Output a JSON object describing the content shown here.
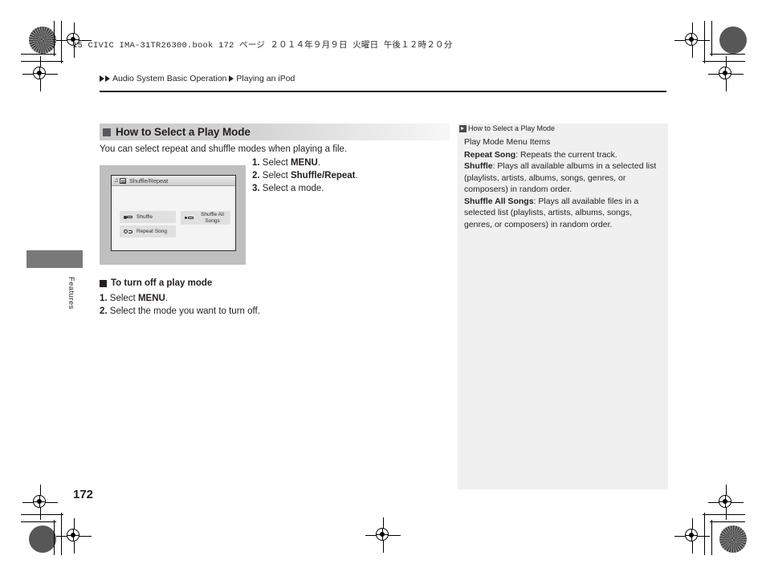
{
  "print": {
    "book_line": "15 CIVIC IMA-31TR26300.book   172 ページ   ２０１４年９月９日   火曜日   午後１２時２０分"
  },
  "breadcrumb": {
    "section": "Audio System Basic Operation",
    "topic": "Playing an iPod",
    "arrow_icon": "triangle-right-icon"
  },
  "heading": {
    "bullet_icon": "filled-square-icon",
    "title": "How to Select a Play Mode"
  },
  "intro": "You can select repeat and shuffle modes when playing a file.",
  "steps": [
    {
      "num": "1.",
      "pre": "Select ",
      "bold": "MENU",
      "post": "."
    },
    {
      "num": "2.",
      "pre": "Select ",
      "bold": "Shuffle/Repeat",
      "post": "."
    },
    {
      "num": "3.",
      "pre": "Select a mode.",
      "bold": "",
      "post": ""
    }
  ],
  "illustration": {
    "title_bar": {
      "music_note_icon": "music-note-icon",
      "list_icon": "list-screen-icon",
      "label": "Shuffle/Repeat"
    },
    "buttons": [
      {
        "icon": "shuffle-icon",
        "label": "Shuffle"
      },
      {
        "icon": "repeat-song-icon",
        "label": "Repeat Song"
      },
      {
        "icon": "shuffle-all-icon",
        "label": "Shuffle All Songs"
      }
    ]
  },
  "turn_off": {
    "bullet_icon": "filled-square-icon",
    "title": "To turn off a play mode",
    "steps": [
      {
        "num": "1.",
        "pre": "Select ",
        "bold": "MENU",
        "post": "."
      },
      {
        "num": "2.",
        "pre": "Select the mode you want to turn off.",
        "bold": "",
        "post": ""
      }
    ]
  },
  "note": {
    "marker_icon": "double-chevron-right-icon",
    "title": "How to Select a Play Mode",
    "subtitle": "Play Mode Menu Items",
    "items": [
      {
        "term": "Repeat Song",
        "desc": ": Repeats the current track."
      },
      {
        "term": "Shuffle",
        "desc": ": Plays all available albums in a selected list (playlists, artists, albums, songs, genres, or composers) in random order."
      },
      {
        "term": "Shuffle All Songs",
        "desc": ": Plays all available files in a selected list (playlists, artists, albums, songs, genres, or composers) in random order."
      }
    ]
  },
  "side_tab": {
    "label": "Features"
  },
  "page_number": "172",
  "colors": {
    "heading_gradient_start": "#c9c9c9",
    "note_panel_bg": "#f0f0f0",
    "side_tab_bg": "#797979",
    "illustration_bg": "#bfbfbf",
    "text": "#231f20"
  }
}
